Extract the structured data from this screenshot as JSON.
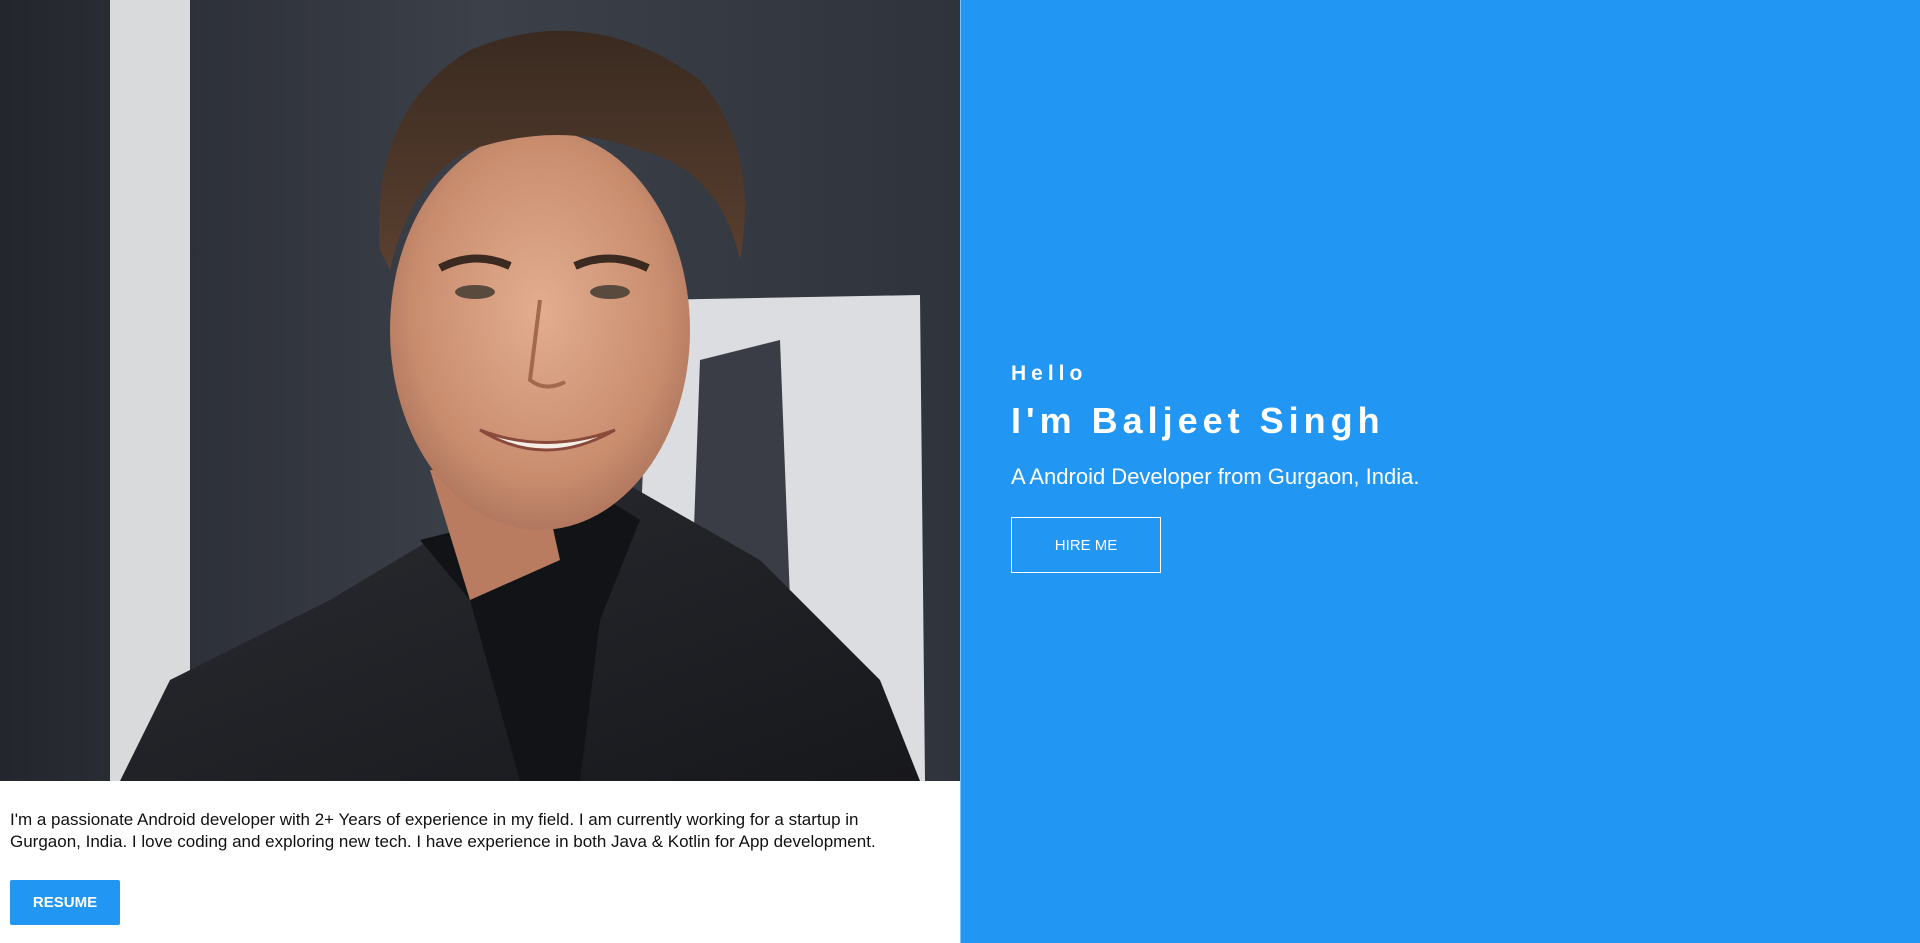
{
  "profile_photo": {
    "alt": "Portrait photo"
  },
  "about": {
    "bio": "I'm a passionate Android developer with 2+ Years of experience in my field. I am currently working for a startup in Gurgaon, India. I love coding and exploring new tech. I have experience in both Java & Kotlin for App development.",
    "resume_label": "RESUME"
  },
  "hero": {
    "greeting": "Hello",
    "name": "I'm Baljeet Singh",
    "tagline": "A Android Developer from Gurgaon, India.",
    "hire_label": "HIRE ME"
  },
  "colors": {
    "accent": "#2196f3",
    "text_on_accent": "#ffffff",
    "body_text": "#111111"
  }
}
